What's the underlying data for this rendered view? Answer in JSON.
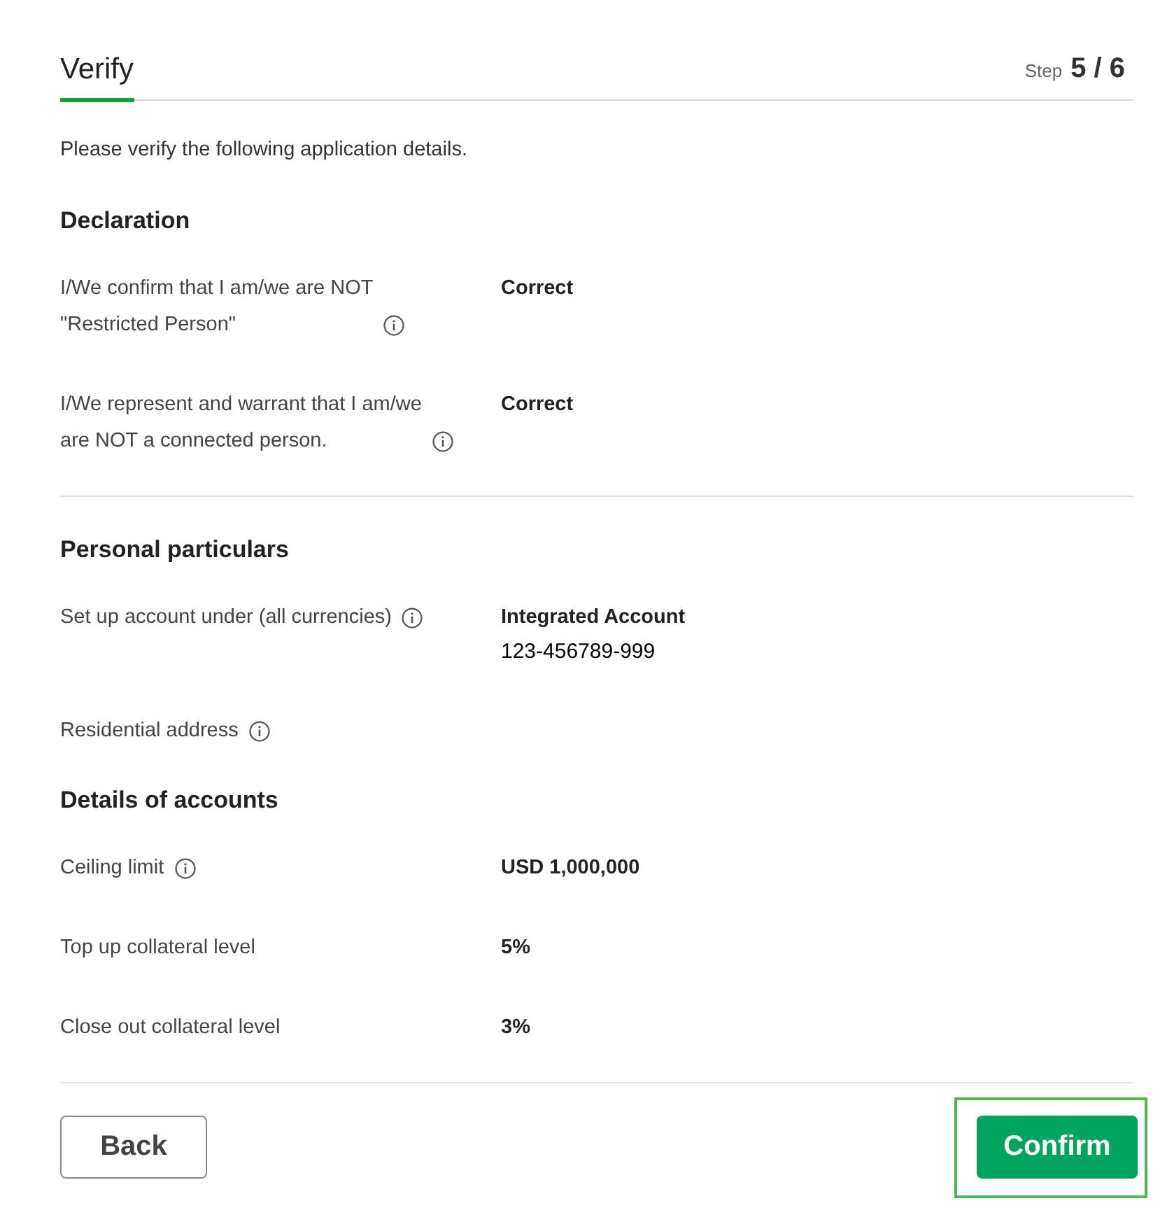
{
  "header": {
    "title": "Verify",
    "step_label": "Step",
    "step": "5 / 6"
  },
  "intro": "Please verify the following application details.",
  "sections": [
    {
      "title": "Declaration",
      "divider_after": true,
      "rows": [
        {
          "label": "I/We confirm that I am/we are NOT \"Restricted Person\"",
          "info": true,
          "value": "Correct"
        },
        {
          "label": "I/We represent and warrant that I am/we are NOT a connected person.",
          "info": true,
          "value": "Correct"
        }
      ]
    },
    {
      "title": "Personal particulars",
      "divider_after": false,
      "rows": [
        {
          "label": "Set up account under (all currencies)",
          "info": true,
          "value": "Integrated Account",
          "account_number": "123-456789-999"
        },
        {
          "label": "Residential address",
          "info": true
        }
      ]
    },
    {
      "title": "Details of accounts",
      "divider_after": true,
      "rows": [
        {
          "label": "Ceiling limit",
          "info": true,
          "value": "USD 1,000,000"
        },
        {
          "label": "Top up collateral level",
          "info": false,
          "value": "5%"
        },
        {
          "label": "Close out collateral level",
          "info": false,
          "value": "3%"
        }
      ]
    }
  ],
  "buttons": [
    {
      "label": "Back",
      "kind": "secondary",
      "highlighted": false
    },
    {
      "label": "Confirm",
      "kind": "primary",
      "highlighted": true
    }
  ]
}
